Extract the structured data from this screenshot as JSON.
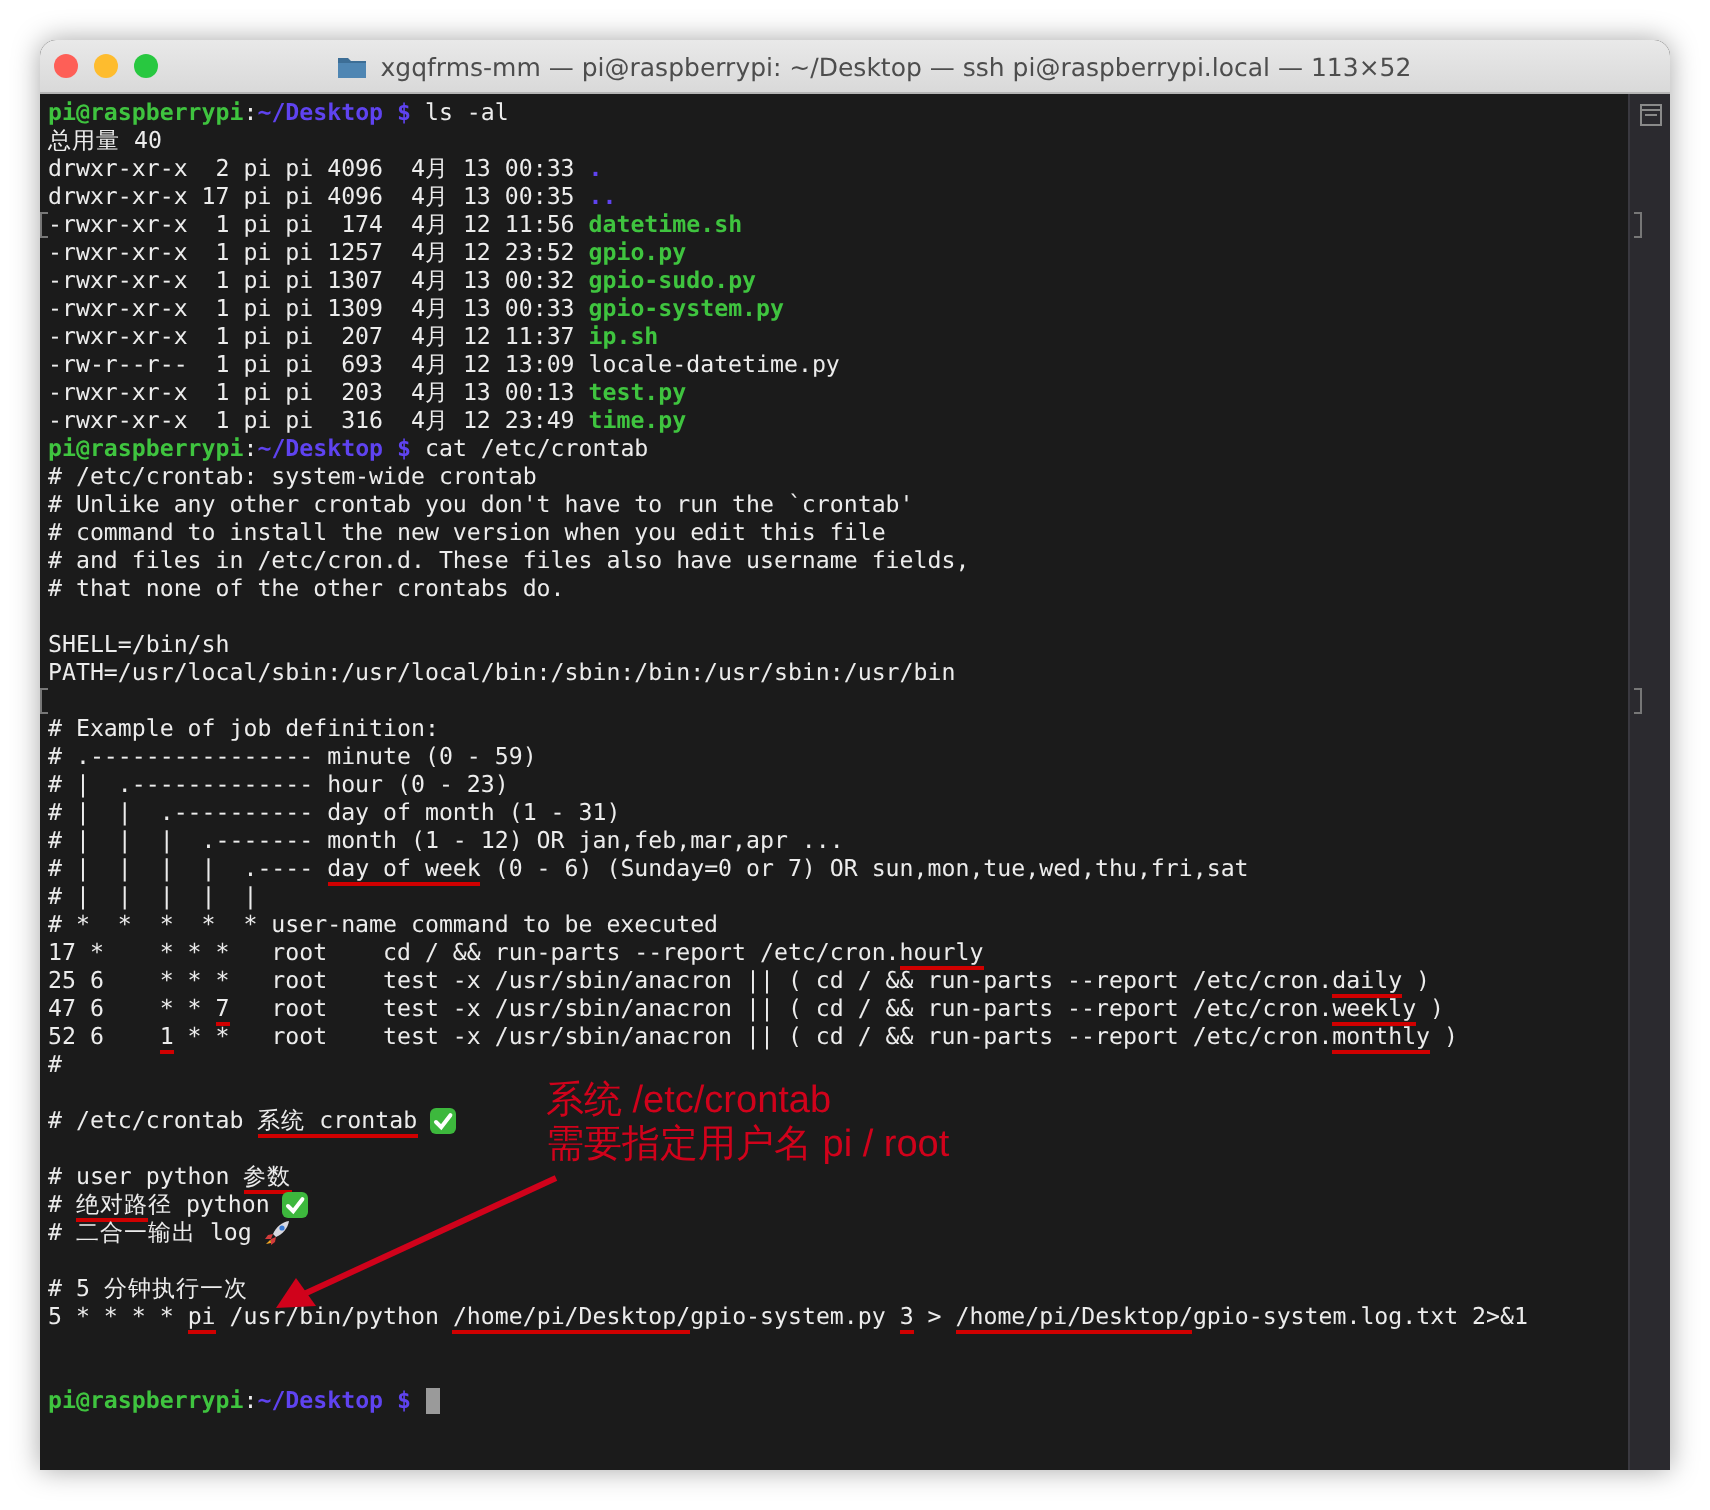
{
  "window": {
    "title": "xgqfrms-mm — pi@raspberrypi: ~/Desktop — ssh pi@raspberrypi.local — 113×52"
  },
  "lines": [
    {
      "kind": "text",
      "segments": [
        {
          "text": "pi@raspberrypi",
          "kind": "user",
          "underlined": false
        },
        {
          "text": ":",
          "kind": "plain",
          "underlined": false
        },
        {
          "text": "~/Desktop $",
          "kind": "cwd",
          "underlined": false
        },
        {
          "text": " ls -al",
          "kind": "plain",
          "underlined": false
        }
      ]
    },
    {
      "kind": "text",
      "segments": [
        {
          "text": "总用量 40",
          "kind": "plain",
          "underlined": false
        }
      ]
    },
    {
      "kind": "text",
      "segments": [
        {
          "text": "drwxr-xr-x  2 pi pi 4096  4月 13 00:33 ",
          "kind": "plain",
          "underlined": false
        },
        {
          "text": ".",
          "kind": "dir",
          "underlined": false
        }
      ]
    },
    {
      "kind": "text",
      "segments": [
        {
          "text": "drwxr-xr-x 17 pi pi 4096  4月 13 00:35 ",
          "kind": "plain",
          "underlined": false
        },
        {
          "text": "..",
          "kind": "dir",
          "underlined": false
        }
      ]
    },
    {
      "kind": "text",
      "bracketed": true,
      "segments": [
        {
          "text": "-rwxr-xr-x  1 pi pi  174  4月 12 11:56 ",
          "kind": "plain",
          "underlined": false
        },
        {
          "text": "datetime.sh",
          "kind": "exec",
          "underlined": false
        }
      ]
    },
    {
      "kind": "text",
      "segments": [
        {
          "text": "-rwxr-xr-x  1 pi pi 1257  4月 12 23:52 ",
          "kind": "plain",
          "underlined": false
        },
        {
          "text": "gpio.py",
          "kind": "exec",
          "underlined": false
        }
      ]
    },
    {
      "kind": "text",
      "segments": [
        {
          "text": "-rwxr-xr-x  1 pi pi 1307  4月 13 00:32 ",
          "kind": "plain",
          "underlined": false
        },
        {
          "text": "gpio-sudo.py",
          "kind": "exec",
          "underlined": false
        }
      ]
    },
    {
      "kind": "text",
      "segments": [
        {
          "text": "-rwxr-xr-x  1 pi pi 1309  4月 13 00:33 ",
          "kind": "plain",
          "underlined": false
        },
        {
          "text": "gpio-system.py",
          "kind": "exec",
          "underlined": false
        }
      ]
    },
    {
      "kind": "text",
      "segments": [
        {
          "text": "-rwxr-xr-x  1 pi pi  207  4月 12 11:37 ",
          "kind": "plain",
          "underlined": false
        },
        {
          "text": "ip.sh",
          "kind": "exec",
          "underlined": false
        }
      ]
    },
    {
      "kind": "text",
      "segments": [
        {
          "text": "-rw-r--r--  1 pi pi  693  4月 12 13:09 locale-datetime.py",
          "kind": "plain",
          "underlined": false
        }
      ]
    },
    {
      "kind": "text",
      "segments": [
        {
          "text": "-rwxr-xr-x  1 pi pi  203  4月 13 00:13 ",
          "kind": "plain",
          "underlined": false
        },
        {
          "text": "test.py",
          "kind": "exec",
          "underlined": false
        }
      ]
    },
    {
      "kind": "text",
      "segments": [
        {
          "text": "-rwxr-xr-x  1 pi pi  316  4月 12 23:49 ",
          "kind": "plain",
          "underlined": false
        },
        {
          "text": "time.py",
          "kind": "exec",
          "underlined": false
        }
      ]
    },
    {
      "kind": "text",
      "segments": [
        {
          "text": "pi@raspberrypi",
          "kind": "user",
          "underlined": false
        },
        {
          "text": ":",
          "kind": "plain",
          "underlined": false
        },
        {
          "text": "~/Desktop $",
          "kind": "cwd",
          "underlined": false
        },
        {
          "text": " cat /etc/crontab",
          "kind": "plain",
          "underlined": false
        }
      ]
    },
    {
      "kind": "text",
      "segments": [
        {
          "text": "# /etc/crontab: system-wide crontab",
          "kind": "plain",
          "underlined": false
        }
      ]
    },
    {
      "kind": "text",
      "segments": [
        {
          "text": "# Unlike any other crontab you don't have to run the `crontab'",
          "kind": "plain",
          "underlined": false
        }
      ]
    },
    {
      "kind": "text",
      "segments": [
        {
          "text": "# command to install the new version when you edit this file",
          "kind": "plain",
          "underlined": false
        }
      ]
    },
    {
      "kind": "text",
      "segments": [
        {
          "text": "# and files in /etc/cron.d. These files also have username fields,",
          "kind": "plain",
          "underlined": false
        }
      ]
    },
    {
      "kind": "text",
      "segments": [
        {
          "text": "# that none of the other crontabs do.",
          "kind": "plain",
          "underlined": false
        }
      ]
    },
    {
      "kind": "blank"
    },
    {
      "kind": "text",
      "segments": [
        {
          "text": "SHELL=/bin/sh",
          "kind": "plain",
          "underlined": false
        }
      ]
    },
    {
      "kind": "text",
      "segments": [
        {
          "text": "PATH=/usr/local/sbin:/usr/local/bin:/sbin:/bin:/usr/sbin:/usr/bin",
          "kind": "plain",
          "underlined": false
        }
      ]
    },
    {
      "kind": "blank",
      "bracketed": true
    },
    {
      "kind": "text",
      "segments": [
        {
          "text": "# Example of job definition:",
          "kind": "plain",
          "underlined": false
        }
      ]
    },
    {
      "kind": "text",
      "segments": [
        {
          "text": "# .---------------- minute (0 - 59)",
          "kind": "plain",
          "underlined": false
        }
      ]
    },
    {
      "kind": "text",
      "segments": [
        {
          "text": "# |  .------------- hour (0 - 23)",
          "kind": "plain",
          "underlined": false
        }
      ]
    },
    {
      "kind": "text",
      "segments": [
        {
          "text": "# |  |  .---------- day of month (1 - 31)",
          "kind": "plain",
          "underlined": false
        }
      ]
    },
    {
      "kind": "text",
      "segments": [
        {
          "text": "# |  |  |  .------- month (1 - 12) OR jan,feb,mar,apr ...",
          "kind": "plain",
          "underlined": false
        }
      ]
    },
    {
      "kind": "text",
      "segments": [
        {
          "text": "# |  |  |  |  .---- ",
          "kind": "plain",
          "underlined": false
        },
        {
          "text": "day of week",
          "kind": "plain",
          "underlined": true
        },
        {
          "text": " (0 - 6) (Sunday=0 or 7) OR sun,mon,tue,wed,thu,fri,sat",
          "kind": "plain",
          "underlined": false
        }
      ]
    },
    {
      "kind": "text",
      "segments": [
        {
          "text": "# |  |  |  |  |",
          "kind": "plain",
          "underlined": false
        }
      ]
    },
    {
      "kind": "text",
      "segments": [
        {
          "text": "# *  *  *  *  * user-name command to be executed",
          "kind": "plain",
          "underlined": false
        }
      ]
    },
    {
      "kind": "text",
      "segments": [
        {
          "text": "17 *    * * *   root    cd / && run-parts --report /etc/cron.",
          "kind": "plain",
          "underlined": false
        },
        {
          "text": "hourly",
          "kind": "plain",
          "underlined": true
        }
      ]
    },
    {
      "kind": "text",
      "segments": [
        {
          "text": "25 6    * * *   root    test -x /usr/sbin/anacron || ( cd / && run-parts --report /etc/cron.",
          "kind": "plain",
          "underlined": false
        },
        {
          "text": "daily",
          "kind": "plain",
          "underlined": true
        },
        {
          "text": " )",
          "kind": "plain",
          "underlined": false
        }
      ]
    },
    {
      "kind": "text",
      "segments": [
        {
          "text": "47 6    * * ",
          "kind": "plain",
          "underlined": false
        },
        {
          "text": "7",
          "kind": "plain",
          "underlined": true
        },
        {
          "text": "   root    test -x /usr/sbin/anacron || ( cd / && run-parts --report /etc/cron.",
          "kind": "plain",
          "underlined": false
        },
        {
          "text": "weekly",
          "kind": "plain",
          "underlined": true
        },
        {
          "text": " )",
          "kind": "plain",
          "underlined": false
        }
      ]
    },
    {
      "kind": "text",
      "segments": [
        {
          "text": "52 6    ",
          "kind": "plain",
          "underlined": false
        },
        {
          "text": "1",
          "kind": "plain",
          "underlined": true
        },
        {
          "text": " * *   root    test -x /usr/sbin/anacron || ( cd / && run-parts --report /etc/cron.",
          "kind": "plain",
          "underlined": false
        },
        {
          "text": "monthly",
          "kind": "plain",
          "underlined": true
        },
        {
          "text": " )",
          "kind": "plain",
          "underlined": false
        }
      ]
    },
    {
      "kind": "text",
      "segments": [
        {
          "text": "#",
          "kind": "plain",
          "underlined": false
        }
      ]
    },
    {
      "kind": "blank"
    },
    {
      "kind": "text",
      "segments": [
        {
          "text": "# /etc/crontab ",
          "kind": "plain",
          "underlined": false
        },
        {
          "text": "系统 crontab",
          "kind": "plain",
          "underlined": true
        },
        {
          "kind": "check"
        }
      ]
    },
    {
      "kind": "blank"
    },
    {
      "kind": "text",
      "segments": [
        {
          "text": "# user python ",
          "kind": "plain",
          "underlined": false
        },
        {
          "text": "参数",
          "kind": "plain",
          "underlined": true
        }
      ]
    },
    {
      "kind": "text",
      "segments": [
        {
          "text": "# ",
          "kind": "plain",
          "underlined": false
        },
        {
          "text": "绝对路",
          "kind": "plain",
          "underlined": true
        },
        {
          "text": "径 python",
          "kind": "plain",
          "underlined": false
        },
        {
          "kind": "check"
        }
      ]
    },
    {
      "kind": "text",
      "segments": [
        {
          "text": "# 二合一输出 log",
          "kind": "plain",
          "underlined": false
        },
        {
          "kind": "rocket"
        }
      ]
    },
    {
      "kind": "blank"
    },
    {
      "kind": "text",
      "segments": [
        {
          "text": "# 5 分钟执行一次",
          "kind": "plain",
          "underlined": false
        }
      ]
    },
    {
      "kind": "text",
      "segments": [
        {
          "text": "5 * * * * ",
          "kind": "plain",
          "underlined": false
        },
        {
          "text": "pi",
          "kind": "plain",
          "underlined": true
        },
        {
          "text": " /usr/bin/python ",
          "kind": "plain",
          "underlined": false
        },
        {
          "text": "/home/pi/Desktop/",
          "kind": "plain",
          "underlined": true
        },
        {
          "text": "gpio-system.py ",
          "kind": "plain",
          "underlined": false
        },
        {
          "text": "3",
          "kind": "plain",
          "underlined": true
        },
        {
          "text": " > ",
          "kind": "plain",
          "underlined": false
        },
        {
          "text": "/home/pi/Desktop/",
          "kind": "plain",
          "underlined": true
        },
        {
          "text": "gpio-system.log.txt 2>&1",
          "kind": "plain",
          "underlined": false
        }
      ]
    },
    {
      "kind": "blank"
    },
    {
      "kind": "blank"
    },
    {
      "kind": "text",
      "cursor": true,
      "segments": [
        {
          "text": "pi@raspberrypi",
          "kind": "user",
          "underlined": false
        },
        {
          "text": ":",
          "kind": "plain",
          "underlined": false
        },
        {
          "text": "~/Desktop $",
          "kind": "cwd",
          "underlined": false
        }
      ]
    }
  ],
  "annotation": {
    "lines": [
      "系统 /etc/crontab",
      "需要指定用户名 pi / root"
    ]
  }
}
